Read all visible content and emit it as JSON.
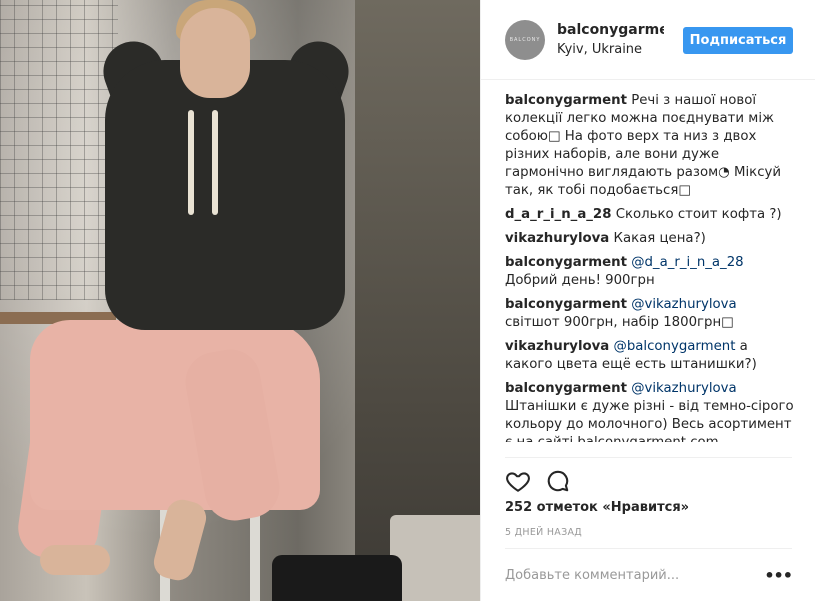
{
  "header": {
    "avatar_text": "BALCONY",
    "username": "balconygarment",
    "location": "Kyiv, Ukraine",
    "follow_label": "Подписаться"
  },
  "comments": [
    {
      "author": "balconygarment",
      "text": "Речі з нашої нової колекції легко можна поєднувати між собою□ На фото верх та низ з двох різних наборів, але вони дуже гармонічно виглядають разом◔ Міксуй так, як тобі подобається□"
    },
    {
      "author": "d_a_r_i_n_a_28",
      "text": "Сколько стоит кофта ?)"
    },
    {
      "author": "vikazhurylova",
      "text": "Какая цена?)"
    },
    {
      "author": "balconygarment",
      "mention": "@d_a_r_i_n_a_28",
      "text": "Добрий день! 900грн"
    },
    {
      "author": "balconygarment",
      "mention": "@vikazhurylova",
      "text": "світшот 900грн, набір 1800грн□"
    },
    {
      "author": "vikazhurylova",
      "mention": "@balconygarment",
      "text": "а какого цвета ещё есть штанишки?)"
    },
    {
      "author": "balconygarment",
      "mention": "@vikazhurylova",
      "text": "Штанішки є дуже різні - від темно-сірого кольору до молочного) Весь асортимент є на сайті balconygarment.com"
    }
  ],
  "actions": {
    "likes": "252 отметок «Нравится»",
    "timestamp": "5 ДНЕЙ НАЗАД",
    "like_icon": "heart-icon",
    "comment_icon": "comment-bubble-icon"
  },
  "add_comment": {
    "placeholder": "Добавьте комментарий...",
    "more_label": "•••"
  },
  "colors": {
    "accent": "#3897f0",
    "mention": "#003569",
    "border": "#efefef"
  }
}
